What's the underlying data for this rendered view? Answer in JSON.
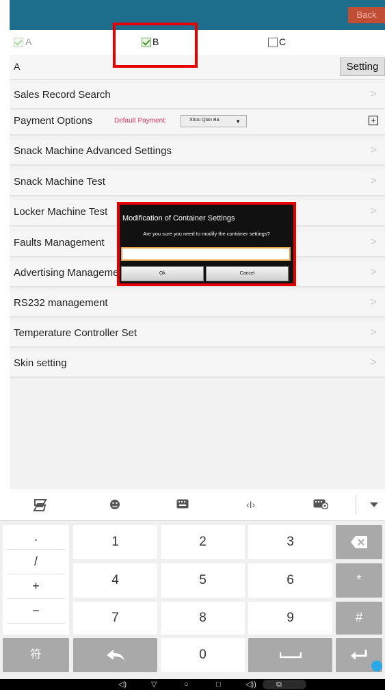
{
  "topbar": {
    "back_label": "Back"
  },
  "checkboxes": {
    "a_label": "A",
    "b_label": "B",
    "c_label": "C"
  },
  "a_row": {
    "label": "A",
    "setting_label": "Setting"
  },
  "menu": {
    "sales_record": "Sales Record Search",
    "payment_options": "Payment Options",
    "default_payment_label": "Default Payment:",
    "default_payment_value": "Shou Qian Ba",
    "snack_advanced": "Snack Machine Advanced Settings",
    "snack_test": "Snack Machine Test",
    "locker_test": "Locker Machine Test",
    "faults": "Faults Management",
    "advertising": "Advertising Management",
    "rs232": "RS232 management",
    "temperature": "Temperature Controller Set",
    "skin": "Skin setting",
    "chevron": ">",
    "plus": "+"
  },
  "dialog": {
    "title": "Modification of Container Settings",
    "message": "Are you sure you need to modify the container settings?",
    "input_value": "",
    "ok_label": "Ok",
    "cancel_label": "Cancel"
  },
  "keyboard": {
    "symbols": [
      ".",
      "/",
      "+",
      "−"
    ],
    "row1": [
      "1",
      "2",
      "3"
    ],
    "row2": [
      "4",
      "5",
      "6"
    ],
    "row3": [
      "7",
      "8",
      "9"
    ],
    "zero": "0",
    "star": "*",
    "hash": "#",
    "fu": "符"
  },
  "colors": {
    "accent": "#1c6e8c",
    "back": "#c24d35",
    "highlight": "#e60000",
    "payment_label": "#d9365a"
  }
}
